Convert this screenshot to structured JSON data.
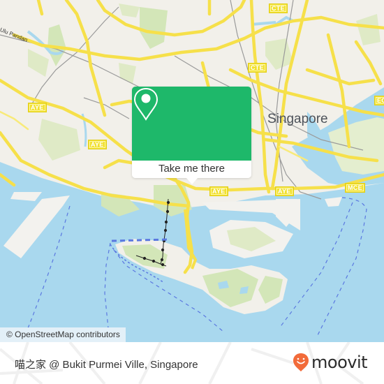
{
  "map": {
    "city_label": "Singapore",
    "area_label": "Ulu Pandan",
    "road_shields": [
      {
        "label": "CTE"
      },
      {
        "label": "CTE"
      },
      {
        "label": "AYE"
      },
      {
        "label": "AYE"
      },
      {
        "label": "AYE"
      },
      {
        "label": "AYE"
      },
      {
        "label": "MCE"
      },
      {
        "label": "ECP"
      }
    ],
    "colors": {
      "land": "#f2f0ea",
      "water": "#a9d8ee",
      "park": "#d3e6b8",
      "road": "#f6e04a",
      "ferry_route": "#5b78e0"
    },
    "attribution": "© OpenStreetMap contributors"
  },
  "popup": {
    "icon": "location-pin-icon",
    "button_label": "Take me there",
    "accent_color": "#1eb86a"
  },
  "footer": {
    "place_name": "喵之家 @ Bukit Purmei Ville, Singapore",
    "brand": {
      "name": "moovit",
      "logo_icon": "moovit-smiley-pin-icon",
      "color": "#f26b3a"
    }
  }
}
